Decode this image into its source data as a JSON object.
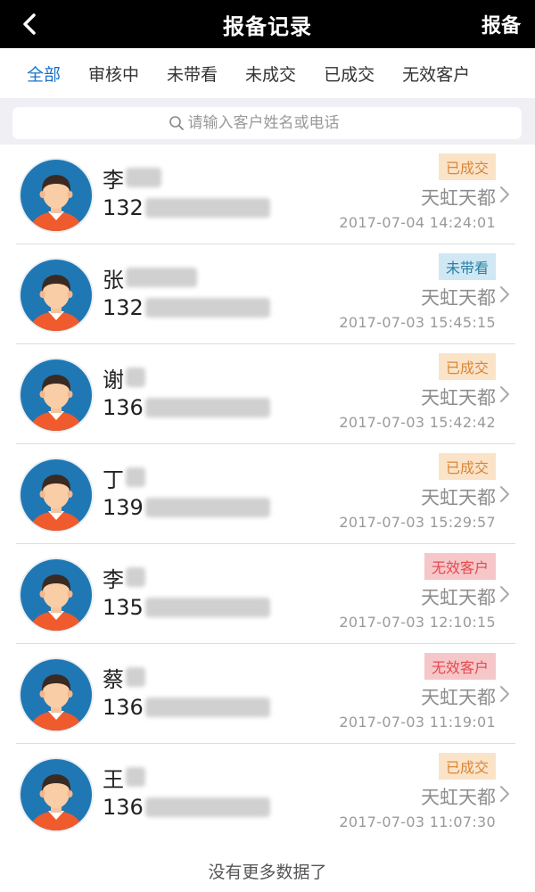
{
  "header": {
    "title": "报备记录",
    "right_action": "报备"
  },
  "tabs": [
    {
      "label": "全部",
      "active": true
    },
    {
      "label": "审核中",
      "active": false
    },
    {
      "label": "未带看",
      "active": false
    },
    {
      "label": "未成交",
      "active": false
    },
    {
      "label": "已成交",
      "active": false
    },
    {
      "label": "无效客户",
      "active": false
    }
  ],
  "search": {
    "placeholder": "请输入客户姓名或电话"
  },
  "records": [
    {
      "surname": "李",
      "phone_prefix": "132",
      "status": "已成交",
      "status_type": "done",
      "project": "天虹天都",
      "datetime": "2017-07-04 14:24:01"
    },
    {
      "surname": "张",
      "phone_prefix": "132",
      "status": "未带看",
      "status_type": "notseen",
      "project": "天虹天都",
      "datetime": "2017-07-03 15:45:15"
    },
    {
      "surname": "谢",
      "phone_prefix": "136",
      "status": "已成交",
      "status_type": "done",
      "project": "天虹天都",
      "datetime": "2017-07-03 15:42:42"
    },
    {
      "surname": "丁",
      "phone_prefix": "139",
      "status": "已成交",
      "status_type": "done",
      "project": "天虹天都",
      "datetime": "2017-07-03 15:29:57"
    },
    {
      "surname": "李",
      "phone_prefix": "135",
      "status": "无效客户",
      "status_type": "invalid",
      "project": "天虹天都",
      "datetime": "2017-07-03 12:10:15"
    },
    {
      "surname": "蔡",
      "phone_prefix": "136",
      "status": "无效客户",
      "status_type": "invalid",
      "project": "天虹天都",
      "datetime": "2017-07-03 11:19:01"
    },
    {
      "surname": "王",
      "phone_prefix": "136",
      "status": "已成交",
      "status_type": "done",
      "project": "天虹天都",
      "datetime": "2017-07-03 11:07:30"
    }
  ],
  "footer_note": "没有更多数据了",
  "colors": {
    "accent": "#1a73c8",
    "done": "#d88637",
    "notseen": "#2a7fa4",
    "invalid": "#e24a4f"
  }
}
